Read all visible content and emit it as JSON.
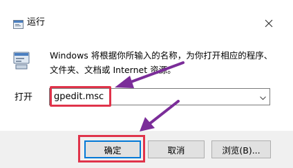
{
  "window": {
    "title": "运行",
    "description": "Windows 将根据你所输入的名称，为你打开相应的程序、\n文件夹、文档或 Internet 资源。"
  },
  "open_field": {
    "label": "打开",
    "value": "gpedit.msc"
  },
  "buttons": {
    "ok": "确定",
    "cancel": "取消",
    "browse": "浏览(B)..."
  },
  "colors": {
    "highlight": "#e0334a",
    "arrow": "#7b2d99",
    "focus": "#0078d7"
  },
  "icons": [
    "run-app-icon",
    "close-icon",
    "run-illustration-icon",
    "dropdown-arrow-icon"
  ]
}
